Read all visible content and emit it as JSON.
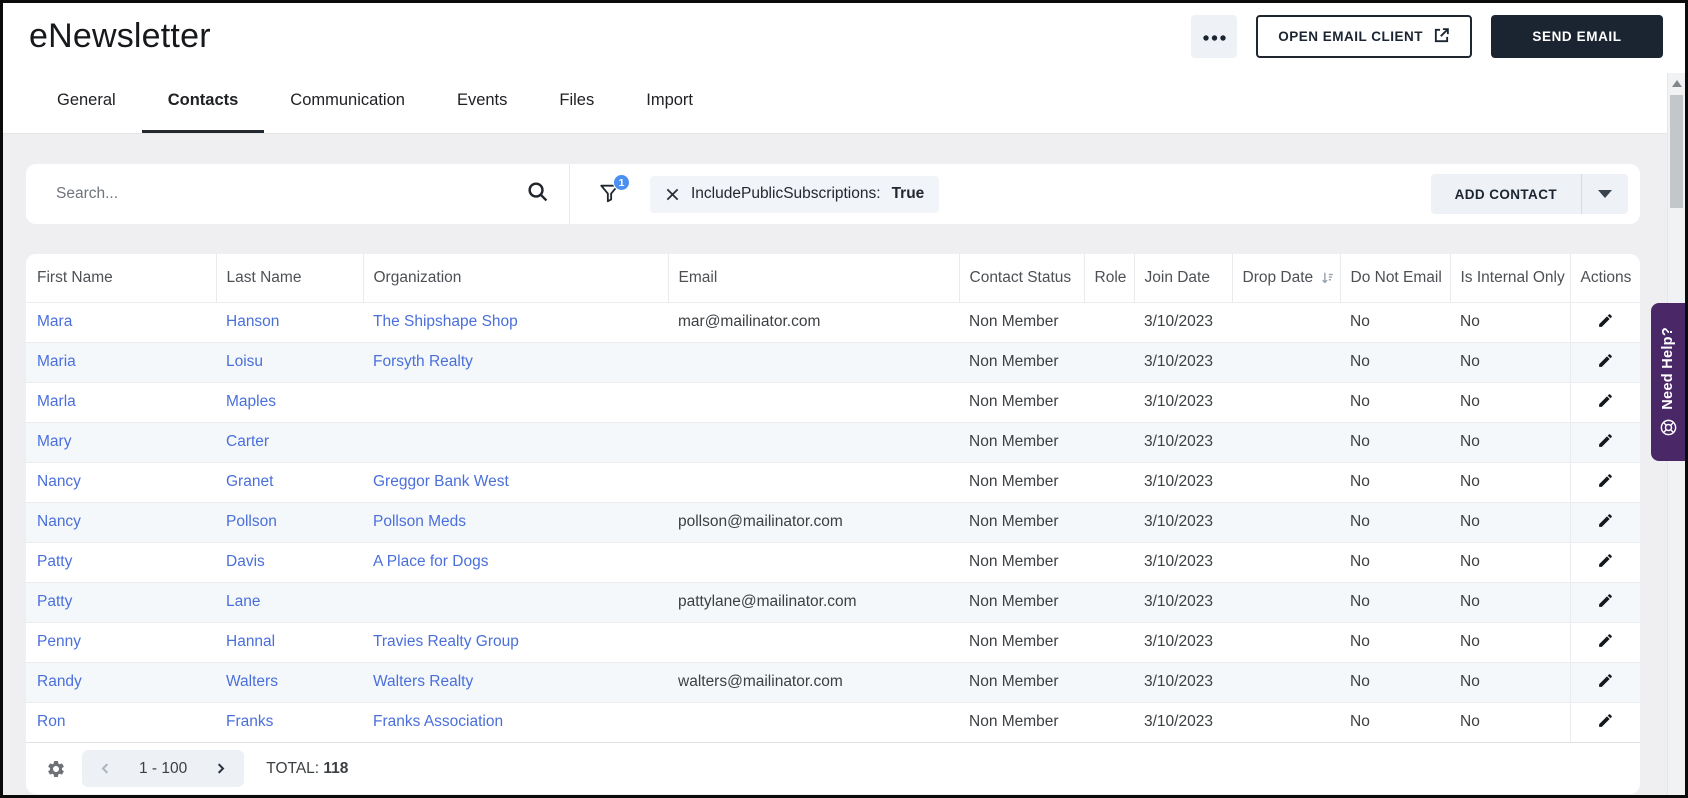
{
  "header": {
    "title": "eNewsletter",
    "open_email_client_label": "OPEN EMAIL CLIENT",
    "send_email_label": "SEND EMAIL"
  },
  "tabs": [
    {
      "label": "General",
      "active": false
    },
    {
      "label": "Contacts",
      "active": true
    },
    {
      "label": "Communication",
      "active": false
    },
    {
      "label": "Events",
      "active": false
    },
    {
      "label": "Files",
      "active": false
    },
    {
      "label": "Import",
      "active": false
    }
  ],
  "toolbar": {
    "search_placeholder": "Search...",
    "filter_badge_count": "1",
    "filter_chip_label": "IncludePublicSubscriptions:",
    "filter_chip_value": "True",
    "add_contact_label": "ADD CONTACT"
  },
  "table": {
    "columns": [
      {
        "label": "First Name"
      },
      {
        "label": "Last Name"
      },
      {
        "label": "Organization"
      },
      {
        "label": "Email"
      },
      {
        "label": "Contact Status"
      },
      {
        "label": "Role"
      },
      {
        "label": "Join Date"
      },
      {
        "label": "Drop Date",
        "sorted": "desc"
      },
      {
        "label": "Do Not Email"
      },
      {
        "label": "Is Internal Only"
      },
      {
        "label": "Actions"
      }
    ],
    "rows": [
      {
        "first_name": "Mara",
        "last_name": "Hanson",
        "organization": "The Shipshape Shop",
        "email": "mar@mailinator.com",
        "contact_status": "Non Member",
        "role": "",
        "join_date": "3/10/2023",
        "drop_date": "",
        "do_not_email": "No",
        "is_internal_only": "No"
      },
      {
        "first_name": "Maria",
        "last_name": "Loisu",
        "organization": "Forsyth Realty",
        "email": "",
        "contact_status": "Non Member",
        "role": "",
        "join_date": "3/10/2023",
        "drop_date": "",
        "do_not_email": "No",
        "is_internal_only": "No"
      },
      {
        "first_name": "Marla",
        "last_name": "Maples",
        "organization": "",
        "email": "",
        "contact_status": "Non Member",
        "role": "",
        "join_date": "3/10/2023",
        "drop_date": "",
        "do_not_email": "No",
        "is_internal_only": "No"
      },
      {
        "first_name": "Mary",
        "last_name": "Carter",
        "organization": "",
        "email": "",
        "contact_status": "Non Member",
        "role": "",
        "join_date": "3/10/2023",
        "drop_date": "",
        "do_not_email": "No",
        "is_internal_only": "No"
      },
      {
        "first_name": "Nancy",
        "last_name": "Granet",
        "organization": "Greggor Bank West",
        "email": "",
        "contact_status": "Non Member",
        "role": "",
        "join_date": "3/10/2023",
        "drop_date": "",
        "do_not_email": "No",
        "is_internal_only": "No"
      },
      {
        "first_name": "Nancy",
        "last_name": "Pollson",
        "organization": "Pollson Meds",
        "email": "pollson@mailinator.com",
        "contact_status": "Non Member",
        "role": "",
        "join_date": "3/10/2023",
        "drop_date": "",
        "do_not_email": "No",
        "is_internal_only": "No"
      },
      {
        "first_name": "Patty",
        "last_name": "Davis",
        "organization": "A Place for Dogs",
        "email": "",
        "contact_status": "Non Member",
        "role": "",
        "join_date": "3/10/2023",
        "drop_date": "",
        "do_not_email": "No",
        "is_internal_only": "No"
      },
      {
        "first_name": "Patty",
        "last_name": "Lane",
        "organization": "",
        "email": "pattylane@mailinator.com",
        "contact_status": "Non Member",
        "role": "",
        "join_date": "3/10/2023",
        "drop_date": "",
        "do_not_email": "No",
        "is_internal_only": "No"
      },
      {
        "first_name": "Penny",
        "last_name": "Hannal",
        "organization": "Travies Realty Group",
        "email": "",
        "contact_status": "Non Member",
        "role": "",
        "join_date": "3/10/2023",
        "drop_date": "",
        "do_not_email": "No",
        "is_internal_only": "No"
      },
      {
        "first_name": "Randy",
        "last_name": "Walters",
        "organization": "Walters Realty",
        "email": "walters@mailinator.com",
        "contact_status": "Non Member",
        "role": "",
        "join_date": "3/10/2023",
        "drop_date": "",
        "do_not_email": "No",
        "is_internal_only": "No"
      },
      {
        "first_name": "Ron",
        "last_name": "Franks",
        "organization": "Franks Association",
        "email": "",
        "contact_status": "Non Member",
        "role": "",
        "join_date": "3/10/2023",
        "drop_date": "",
        "do_not_email": "No",
        "is_internal_only": "No"
      }
    ]
  },
  "footer": {
    "page_range": "1 - 100",
    "total_label": "TOTAL:",
    "total_value": "118"
  },
  "help_tab": {
    "label": "Need Help?"
  },
  "colors": {
    "accent_dark": "#1b2431",
    "link_blue": "#4a6fdb",
    "filter_badge_blue": "#4a90f2",
    "help_purple": "#4a2767",
    "row_alt": "#f4f8fb"
  }
}
